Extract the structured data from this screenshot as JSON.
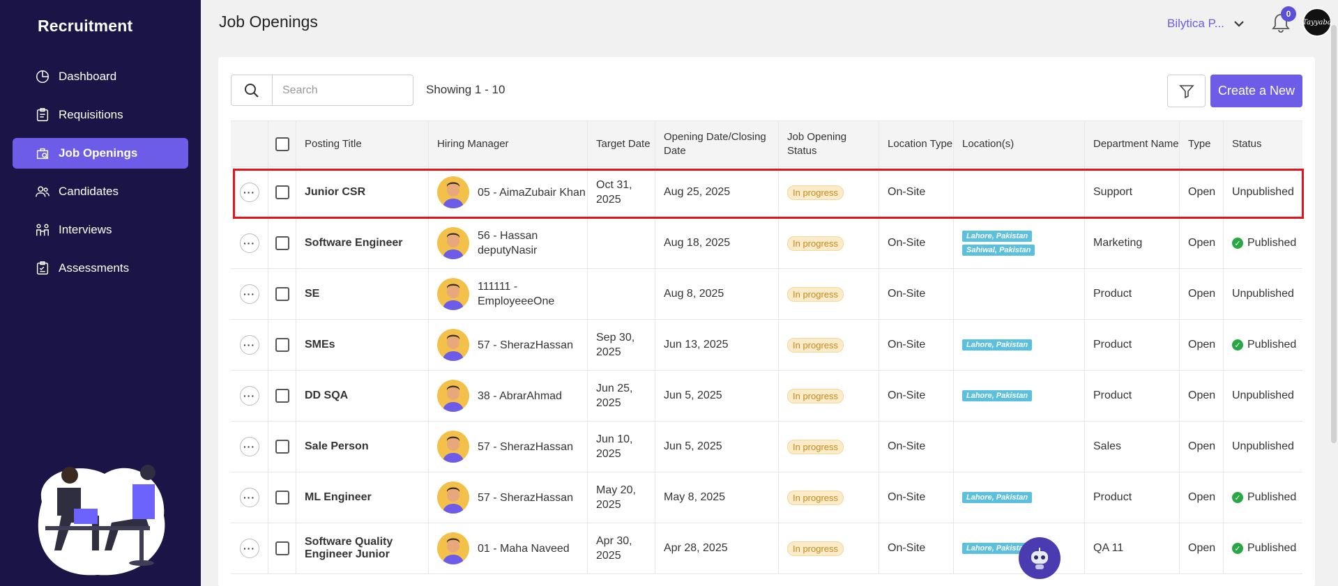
{
  "sidebar": {
    "brand": "Recruitment",
    "items": [
      {
        "label": "Dashboard",
        "icon": "pie-chart-icon"
      },
      {
        "label": "Requisitions",
        "icon": "clipboard-icon"
      },
      {
        "label": "Job Openings",
        "icon": "bag-search-icon",
        "active": true
      },
      {
        "label": "Candidates",
        "icon": "users-icon"
      },
      {
        "label": "Interviews",
        "icon": "interview-icon"
      },
      {
        "label": "Assessments",
        "icon": "checklist-icon"
      }
    ]
  },
  "header": {
    "title": "Job Openings",
    "org": "Bilytica P...",
    "notifications": "0"
  },
  "toolbar": {
    "search_placeholder": "Search",
    "showing": "Showing 1 - 10",
    "create_label": "Create a New"
  },
  "table": {
    "headers": {
      "posting_title": "Posting Title",
      "hiring_manager": "Hiring Manager",
      "target_date": "Target Date",
      "opening_date": "Opening Date/Closing Date",
      "status": "Job Opening Status",
      "location_type": "Location Type",
      "locations": "Location(s)",
      "department": "Department Name",
      "type": "Type",
      "publish": "Status"
    },
    "rows": [
      {
        "title": "Junior CSR",
        "manager": "05 - AimaZubair Khan",
        "target": "Oct 31, 2025",
        "opening": "Aug 25, 2025",
        "status": "In progress",
        "loc_type": "On-Site",
        "locations": [],
        "dept": "Support",
        "type": "Open",
        "publish": "Unpublished",
        "published": false
      },
      {
        "title": "Software Engineer",
        "manager": "56 - Hassan deputyNasir",
        "target": "",
        "opening": "Aug 18, 2025",
        "status": "In progress",
        "loc_type": "On-Site",
        "locations": [
          "Lahore, Pakistan",
          "Sahiwal, Pakistan"
        ],
        "dept": "Marketing",
        "type": "Open",
        "publish": "Published",
        "published": true
      },
      {
        "title": "SE",
        "manager": "111111 - EmployeeeOne",
        "target": "",
        "opening": "Aug 8, 2025",
        "status": "In progress",
        "loc_type": "On-Site",
        "locations": [],
        "dept": "Product",
        "type": "Open",
        "publish": "Unpublished",
        "published": false
      },
      {
        "title": "SMEs",
        "manager": "57 - SherazHassan",
        "target": "Sep 30, 2025",
        "opening": "Jun 13, 2025",
        "status": "In progress",
        "loc_type": "On-Site",
        "locations": [
          "Lahore, Pakistan"
        ],
        "dept": "Product",
        "type": "Open",
        "publish": "Published",
        "published": true
      },
      {
        "title": "DD SQA",
        "manager": "38 - AbrarAhmad",
        "target": "Jun 25, 2025",
        "opening": "Jun 5, 2025",
        "status": "In progress",
        "loc_type": "On-Site",
        "locations": [
          "Lahore, Pakistan"
        ],
        "dept": "Product",
        "type": "Open",
        "publish": "Unpublished",
        "published": false
      },
      {
        "title": "Sale Person",
        "manager": "57 - SherazHassan",
        "target": "Jun 10, 2025",
        "opening": "Jun 5, 2025",
        "status": "In progress",
        "loc_type": "On-Site",
        "locations": [],
        "dept": "Sales",
        "type": "Open",
        "publish": "Unpublished",
        "published": false
      },
      {
        "title": "ML Engineer",
        "manager": "57 - SherazHassan",
        "target": "May 20, 2025",
        "opening": "May 8, 2025",
        "status": "In progress",
        "loc_type": "On-Site",
        "locations": [
          "Lahore, Pakistan"
        ],
        "dept": "Product",
        "type": "Open",
        "publish": "Published",
        "published": true
      },
      {
        "title": "Software Quality Engineer Junior",
        "manager": "01 - Maha Naveed",
        "target": "Apr 30, 2025",
        "opening": "Apr 28, 2025",
        "status": "In progress",
        "loc_type": "On-Site",
        "locations": [
          "Lahore, Pakistan"
        ],
        "dept": "QA 11",
        "type": "Open",
        "publish": "Published",
        "published": true
      }
    ]
  },
  "avatar_label": "Tayyaba"
}
